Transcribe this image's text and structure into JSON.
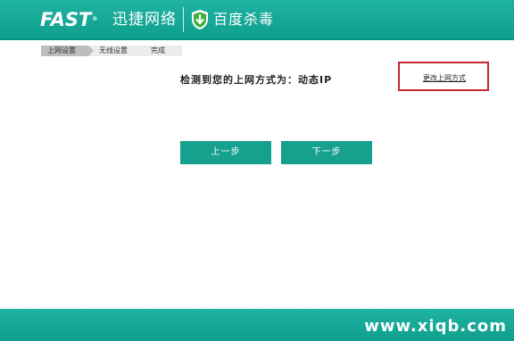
{
  "header": {
    "brand": "FAST",
    "brand_cn": "迅捷网络",
    "partner": "百度杀毒",
    "colors": {
      "bar": "#16a08e",
      "highlight": "#c7262c"
    }
  },
  "steps": [
    "上网设置",
    "无线设置",
    "完成"
  ],
  "active_step": "上网设置",
  "main": {
    "detect_text": "检测到您的上网方式为：动态IP",
    "change_link": "更改上网方式"
  },
  "buttons": {
    "prev": "上一步",
    "next": "下一步"
  },
  "watermark": "www.xiqb.com"
}
